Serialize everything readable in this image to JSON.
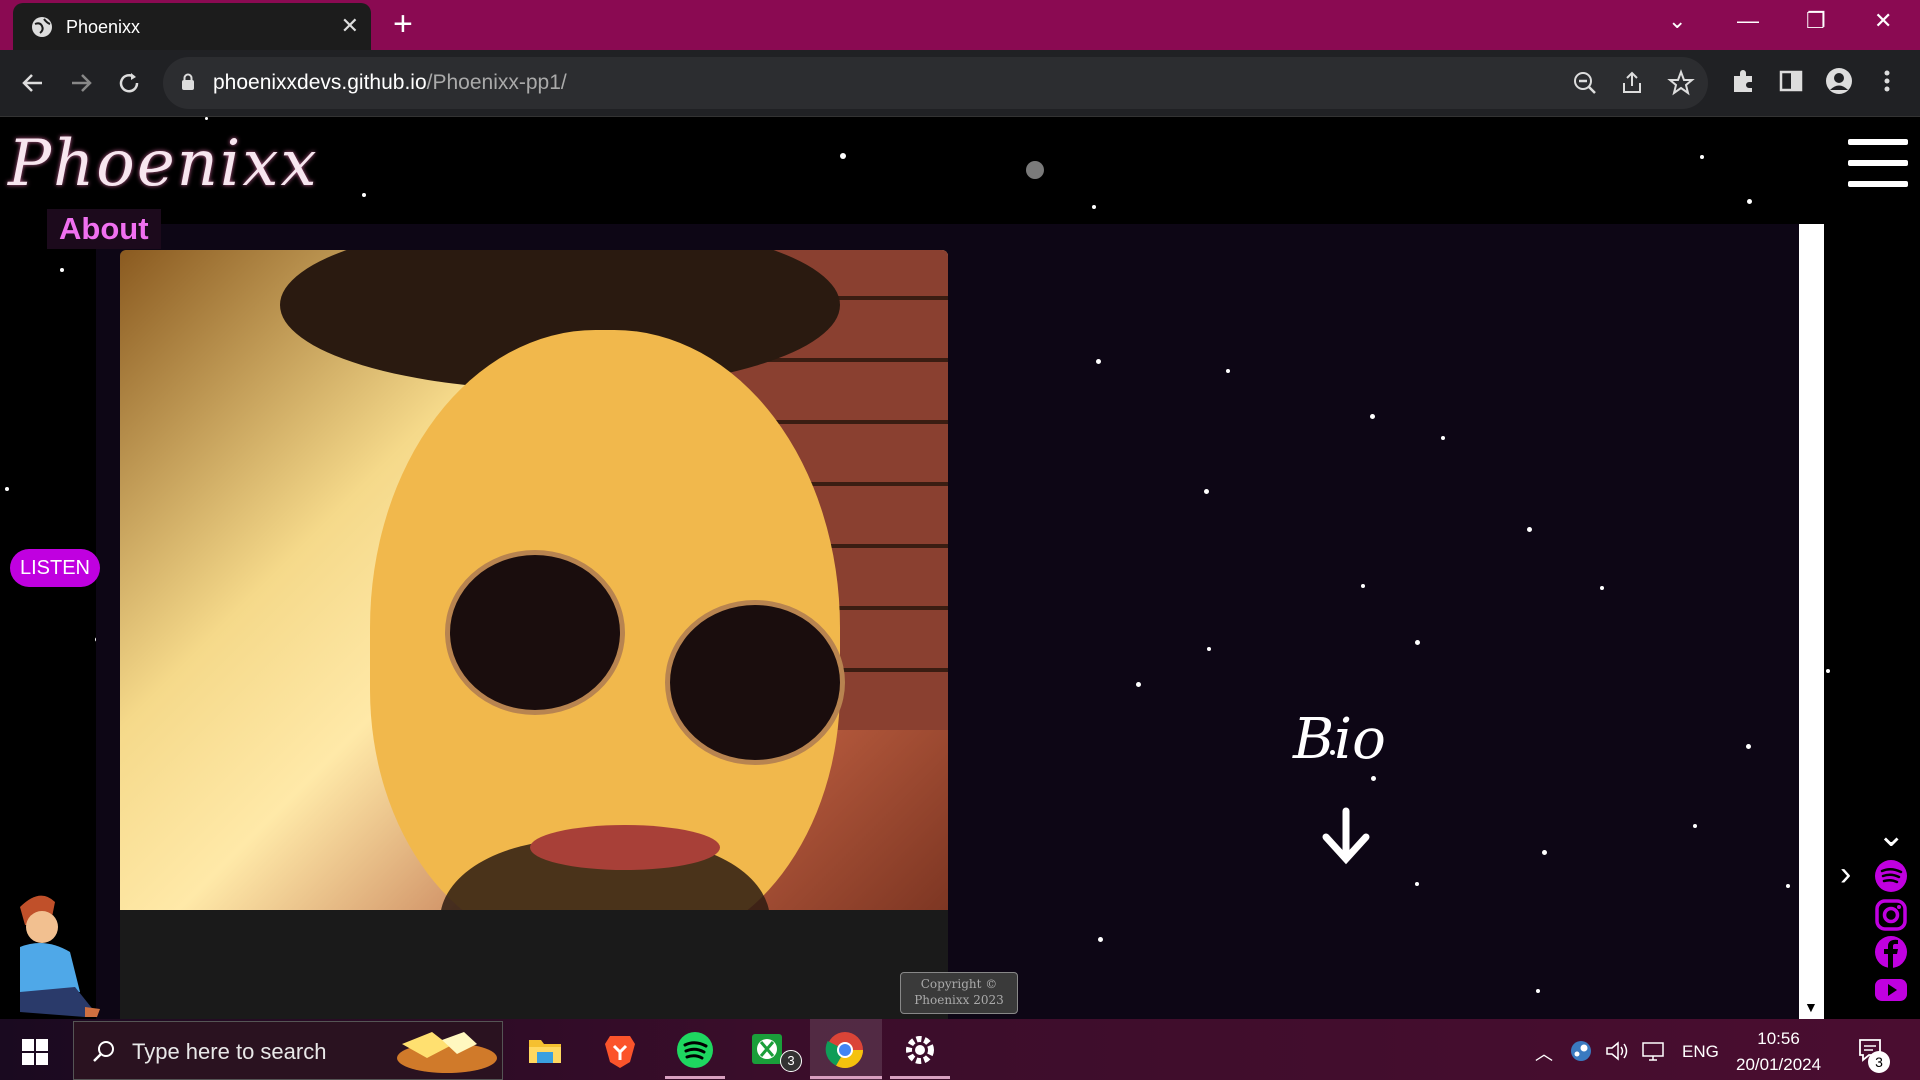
{
  "browser": {
    "tab_title": "Phoenixx",
    "tab_close": "✕",
    "new_tab": "+",
    "url_host": "phoenixxdevs.github.io",
    "url_path": "/Phoenixx-pp1/",
    "window_controls": [
      "⌄",
      "—",
      "❐",
      "✕"
    ]
  },
  "page": {
    "logo": "Phoenixx",
    "section_tab": "About",
    "listen_button": "LISTEN",
    "bio_heading": "Bio",
    "copyright_line1": "Copyright ©",
    "copyright_line2": "Phoenixx 2023",
    "social_links": [
      "spotify-icon",
      "instagram-icon",
      "facebook-icon",
      "youtube-icon"
    ],
    "colors": {
      "accent": "#c000e0",
      "panel": "#0d0615",
      "tab_bar": "#8a0a52",
      "about_text": "#f070f0"
    }
  },
  "taskbar": {
    "search_placeholder": "Type here to search",
    "language": "ENG",
    "time": "10:56",
    "date": "20/01/2024",
    "xbox_badge": "3",
    "notification_badge": "3"
  }
}
